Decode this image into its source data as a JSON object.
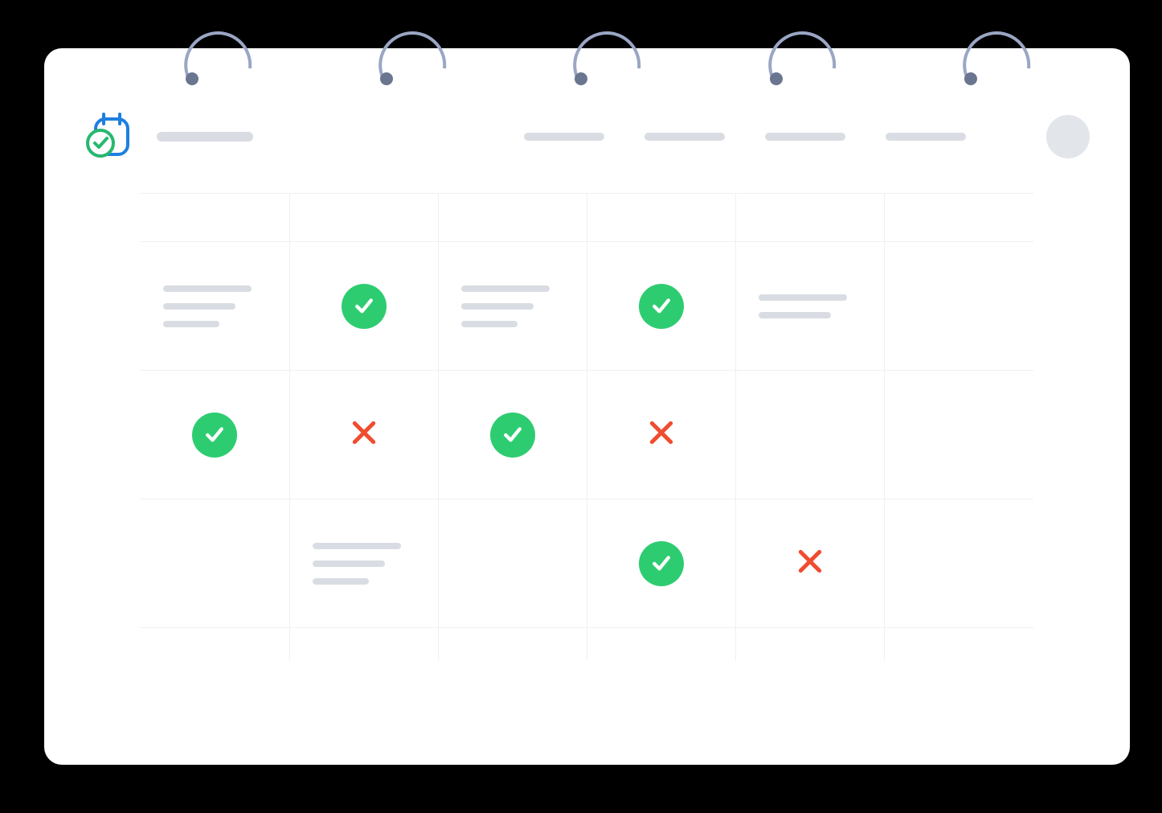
{
  "icons": {
    "check": "check-icon",
    "cross": "cross-icon",
    "logo": "calendar-check-logo",
    "spiral": "spiral-binder"
  },
  "colors": {
    "check_bg": "#2ecc71",
    "check_fg": "#ffffff",
    "cross": "#f04c2f",
    "placeholder": "#d9dde3",
    "spiral_stroke": "#9aa6c4",
    "spiral_dot": "#6a7590",
    "logo_blue": "#1e7fe0",
    "logo_green": "#27b86f"
  },
  "header": {
    "brand_placeholder": "",
    "nav_items": [
      "",
      "",
      "",
      ""
    ],
    "avatar_placeholder": ""
  },
  "grid": {
    "columns": 6,
    "rows": [
      [
        {
          "type": "lines",
          "lines": 3
        },
        {
          "type": "check"
        },
        {
          "type": "lines",
          "lines": 3
        },
        {
          "type": "check"
        },
        {
          "type": "lines",
          "lines": 2
        },
        {
          "type": "empty"
        }
      ],
      [
        {
          "type": "check"
        },
        {
          "type": "cross"
        },
        {
          "type": "check"
        },
        {
          "type": "cross"
        },
        {
          "type": "empty"
        },
        {
          "type": "empty"
        }
      ],
      [
        {
          "type": "empty"
        },
        {
          "type": "lines",
          "lines": 3
        },
        {
          "type": "empty"
        },
        {
          "type": "check"
        },
        {
          "type": "cross"
        },
        {
          "type": "empty"
        }
      ]
    ]
  }
}
